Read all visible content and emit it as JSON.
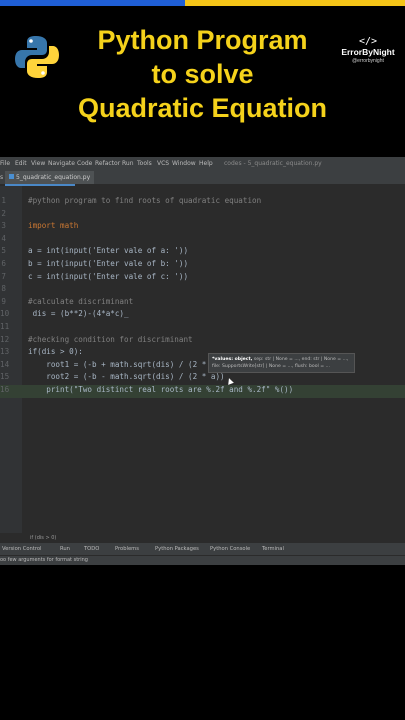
{
  "banner": {
    "title_lines": [
      "Python Program",
      "to solve",
      "Quadratic Equation"
    ],
    "brand_glyph": "</>",
    "brand_name": "ErrorByNight",
    "brand_handle": "@errorbynight",
    "logo_icon": "python-logo-icon"
  },
  "ide": {
    "menu": [
      "File",
      "Edit",
      "View",
      "Navigate",
      "Code",
      "Refactor",
      "Run",
      "Tools",
      "VCS",
      "Window",
      "Help"
    ],
    "project_title": "codes - 5_quadratic_equation.py",
    "tab_prefix": "s",
    "active_tab": "5_quadratic_equation.py",
    "code_lines": [
      {
        "n": "1",
        "text": "#python program to find roots of quadratic equation"
      },
      {
        "n": "2",
        "text": ""
      },
      {
        "n": "3",
        "text": "import math"
      },
      {
        "n": "4",
        "text": ""
      },
      {
        "n": "5",
        "text": "a = int(input('Enter vale of a: '))"
      },
      {
        "n": "6",
        "text": "b = int(input('Enter vale of b: '))"
      },
      {
        "n": "7",
        "text": "c = int(input('Enter vale of c: '))"
      },
      {
        "n": "8",
        "text": ""
      },
      {
        "n": "9",
        "text": "#calculate discriminant"
      },
      {
        "n": "10",
        "text": " dis = (b**2)-(4*a*c)_"
      },
      {
        "n": "11",
        "text": ""
      },
      {
        "n": "12",
        "text": "#checking condition for discriminant"
      },
      {
        "n": "13",
        "text": "if(dis > 0):"
      },
      {
        "n": "14",
        "text": "    root1 = (-b + math.sqrt(dis) / (2 *"
      },
      {
        "n": "15",
        "text": "    root2 = (-b - math.sqrt(dis) / (2 * a))"
      },
      {
        "n": "16",
        "text": "    print(\"Two distinct real roots are %.2f and %.2f\" %())"
      }
    ],
    "tooltip_line1_bold": "*values: object,",
    "tooltip_line1_rest": " sep: str | None = ..., end: str | None = ...,",
    "tooltip_line2": "file: SupportsWrite[str] | None = ..., flush: bool = ...",
    "breadcrumb": "if (dis > 0)",
    "tool_windows": [
      "Version Control",
      "Run",
      "TODO",
      "Problems",
      "Python Packages",
      "Python Console",
      "Terminal"
    ],
    "status_message": "oo few arguments for format string"
  }
}
